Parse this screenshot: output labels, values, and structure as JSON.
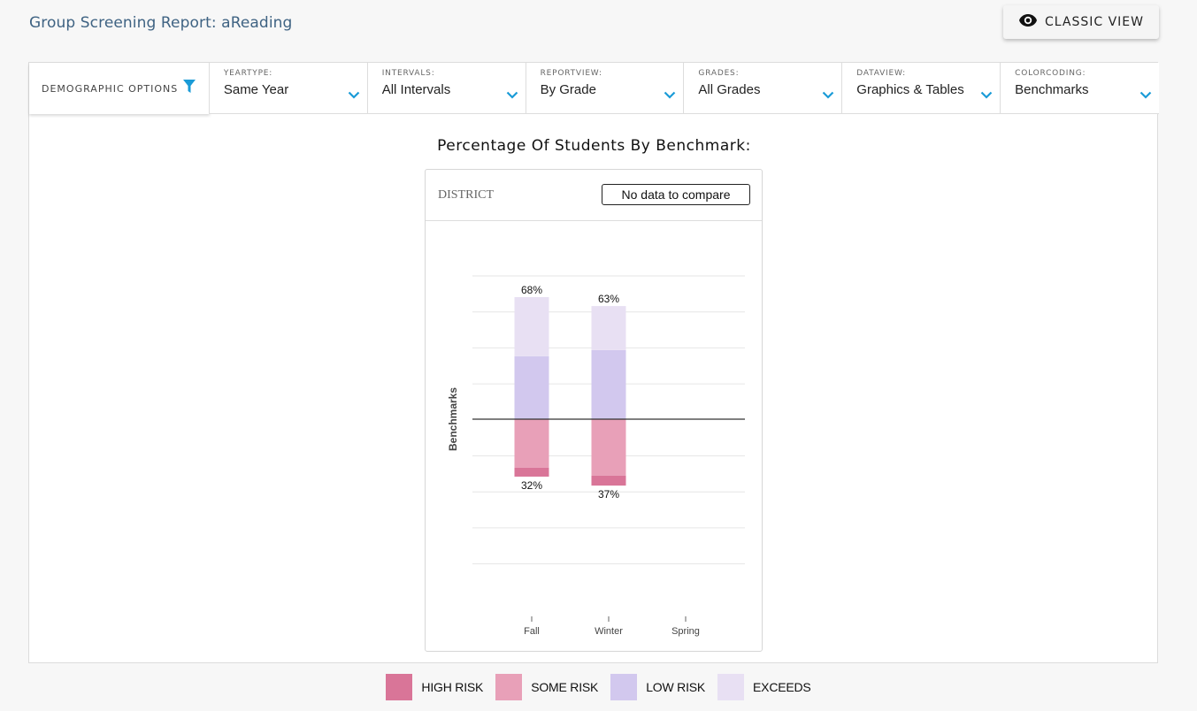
{
  "header": {
    "title": "Group Screening Report: aReading",
    "classic_view_label": "CLASSIC VIEW"
  },
  "filters": {
    "demographic_label": "DEMOGRAPHIC OPTIONS",
    "dropdowns": [
      {
        "caption": "YEARTYPE:",
        "value": "Same Year"
      },
      {
        "caption": "INTERVALS:",
        "value": "All Intervals"
      },
      {
        "caption": "REPORTVIEW:",
        "value": "By Grade"
      },
      {
        "caption": "GRADES:",
        "value": "All Grades"
      },
      {
        "caption": "DATAVIEW:",
        "value": "Graphics & Tables"
      },
      {
        "caption": "COLORCODING:",
        "value": "Benchmarks"
      }
    ]
  },
  "colors": {
    "accent": "#1a9bd7",
    "high_risk": "#d97598",
    "some_risk": "#e8a0b8",
    "low_risk": "#d2c8ee",
    "exceeds": "#e8e0f3"
  },
  "chart": {
    "title": "Percentage Of Students By Benchmark:",
    "card_label": "DISTRICT",
    "compare_label": "No data to compare"
  },
  "chart_data": {
    "type": "bar",
    "stacked": "diverging",
    "ylabel": "Benchmarks",
    "categories": [
      "Fall",
      "Winter",
      "Spring"
    ],
    "series": [
      {
        "name": "HIGH RISK",
        "values": [
          5,
          5.5,
          null
        ]
      },
      {
        "name": "SOME RISK",
        "values": [
          27,
          31.5,
          null
        ]
      },
      {
        "name": "LOW RISK",
        "values": [
          35,
          38.5,
          null
        ]
      },
      {
        "name": "EXCEEDS",
        "values": [
          33,
          24.5,
          null
        ]
      }
    ],
    "above_totals": [
      "68%",
      "63%",
      ""
    ],
    "below_totals": [
      "32%",
      "37%",
      ""
    ],
    "grid": true
  },
  "legend": [
    {
      "label": "HIGH RISK",
      "color": "#d97598"
    },
    {
      "label": "SOME RISK",
      "color": "#e8a0b8"
    },
    {
      "label": "LOW RISK",
      "color": "#d2c8ee"
    },
    {
      "label": "EXCEEDS",
      "color": "#e8e0f3"
    }
  ]
}
